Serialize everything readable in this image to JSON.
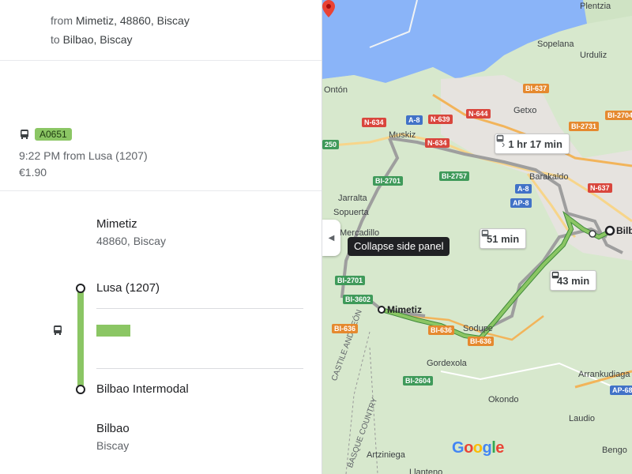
{
  "route": {
    "from_prefix": "from",
    "from_value": "Mimetiz, 48860, Biscay",
    "to_prefix": "to",
    "to_value": "Bilbao, Biscay"
  },
  "schedule": {
    "line_badge": "A0651",
    "departure": "9:22 PM from Lusa (1207)",
    "price": "€1.90"
  },
  "stops": {
    "origin_name": "Mimetiz",
    "origin_sub": "48860, Biscay",
    "board_stop": "Lusa (1207)",
    "alight_stop": "Bilbao Intermodal",
    "dest_name": "Bilbao",
    "dest_sub": "Biscay"
  },
  "map": {
    "collapse_tooltip": "Collapse side panel",
    "callouts": {
      "route1": "1 hr 17 min",
      "route2": "51 min",
      "route3": "43 min"
    },
    "places": {
      "plentzia": "Plentzia",
      "sopelana": "Sopelana",
      "urduliz": "Urduliz",
      "onton": "Ontón",
      "getxo": "Getxo",
      "muskiz": "Muskiz",
      "barakaldo": "Barakaldo",
      "jarralta": "Jarralta",
      "sopuerta": "Sopuerta",
      "mercadillo": "Mercadillo",
      "mimetiz": "Mimetiz",
      "sodupe": "Sodupe",
      "gordexola": "Gordexola",
      "okondo": "Okondo",
      "laudio": "Laudio",
      "arrankudiaga": "Arrankudiaga",
      "artziniega": "Artziniega",
      "bengoa": "Bengo",
      "bilbao": "Bilb",
      "castile": "CASTILE AND LEÓN",
      "basque": "BASQUE COUNTRY",
      "llanteno": "Llanteno"
    },
    "roads": {
      "bi637": "BI-637",
      "bi2731": "BI-2731",
      "bi2704": "BI-2704",
      "a8a": "A-8",
      "n639": "N-639",
      "n644": "N-644",
      "n634a": "N-634",
      "n634b": "N-634",
      "bi2757": "BI-2757",
      "a8b": "A-8",
      "ap8": "AP-8",
      "n637": "N-637",
      "bi2701a": "BI-2701",
      "bi2701b": "BI-2701",
      "bi3602": "BI-3602",
      "bi636a": "BI-636",
      "bi636b": "BI-636",
      "bi636c": "BI-636",
      "bi2604": "BI-2604",
      "ap68": "AP-68",
      "x250": "250"
    },
    "logo": "Google"
  }
}
